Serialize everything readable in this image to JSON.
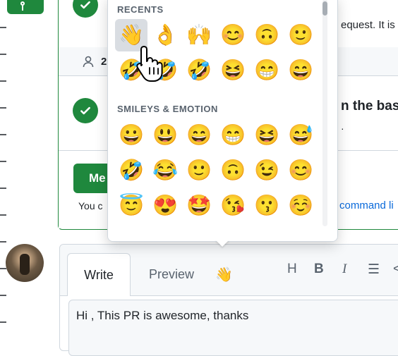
{
  "timeline_icon": "git-merge-icon",
  "merge_box": {
    "row1_text": "equest. It is",
    "row1_icon": "check-icon",
    "reviewer_count": "2",
    "row2_text": "n the base",
    "row3_text": "You c",
    "merge_button_label": "Me",
    "command_link": "command li"
  },
  "emoji_picker": {
    "recents_title": "RECENTS",
    "recents": [
      "👋",
      "👌",
      "🙌",
      "😊",
      "🙃",
      "🙂",
      "🤣",
      "🤣",
      "🤣",
      "😆",
      "😁",
      "😄"
    ],
    "smileys_title": "SMILEYS & EMOTION",
    "smileys": [
      "😀",
      "😃",
      "😄",
      "😁",
      "😆",
      "😅",
      "🤣",
      "😂",
      "🙂",
      "🙃",
      "😉",
      "😊",
      "😇",
      "😍",
      "🤩",
      "😘",
      "😗",
      "☺️"
    ],
    "selected_index": 0
  },
  "comment": {
    "tab_write": "Write",
    "tab_preview": "Preview",
    "emoji_button": "👋",
    "toolbar": {
      "heading": "H",
      "bold": "B",
      "italic": "I",
      "list": "☰",
      "code": "<"
    },
    "body_text": "Hi , This PR is awesome, thanks"
  }
}
